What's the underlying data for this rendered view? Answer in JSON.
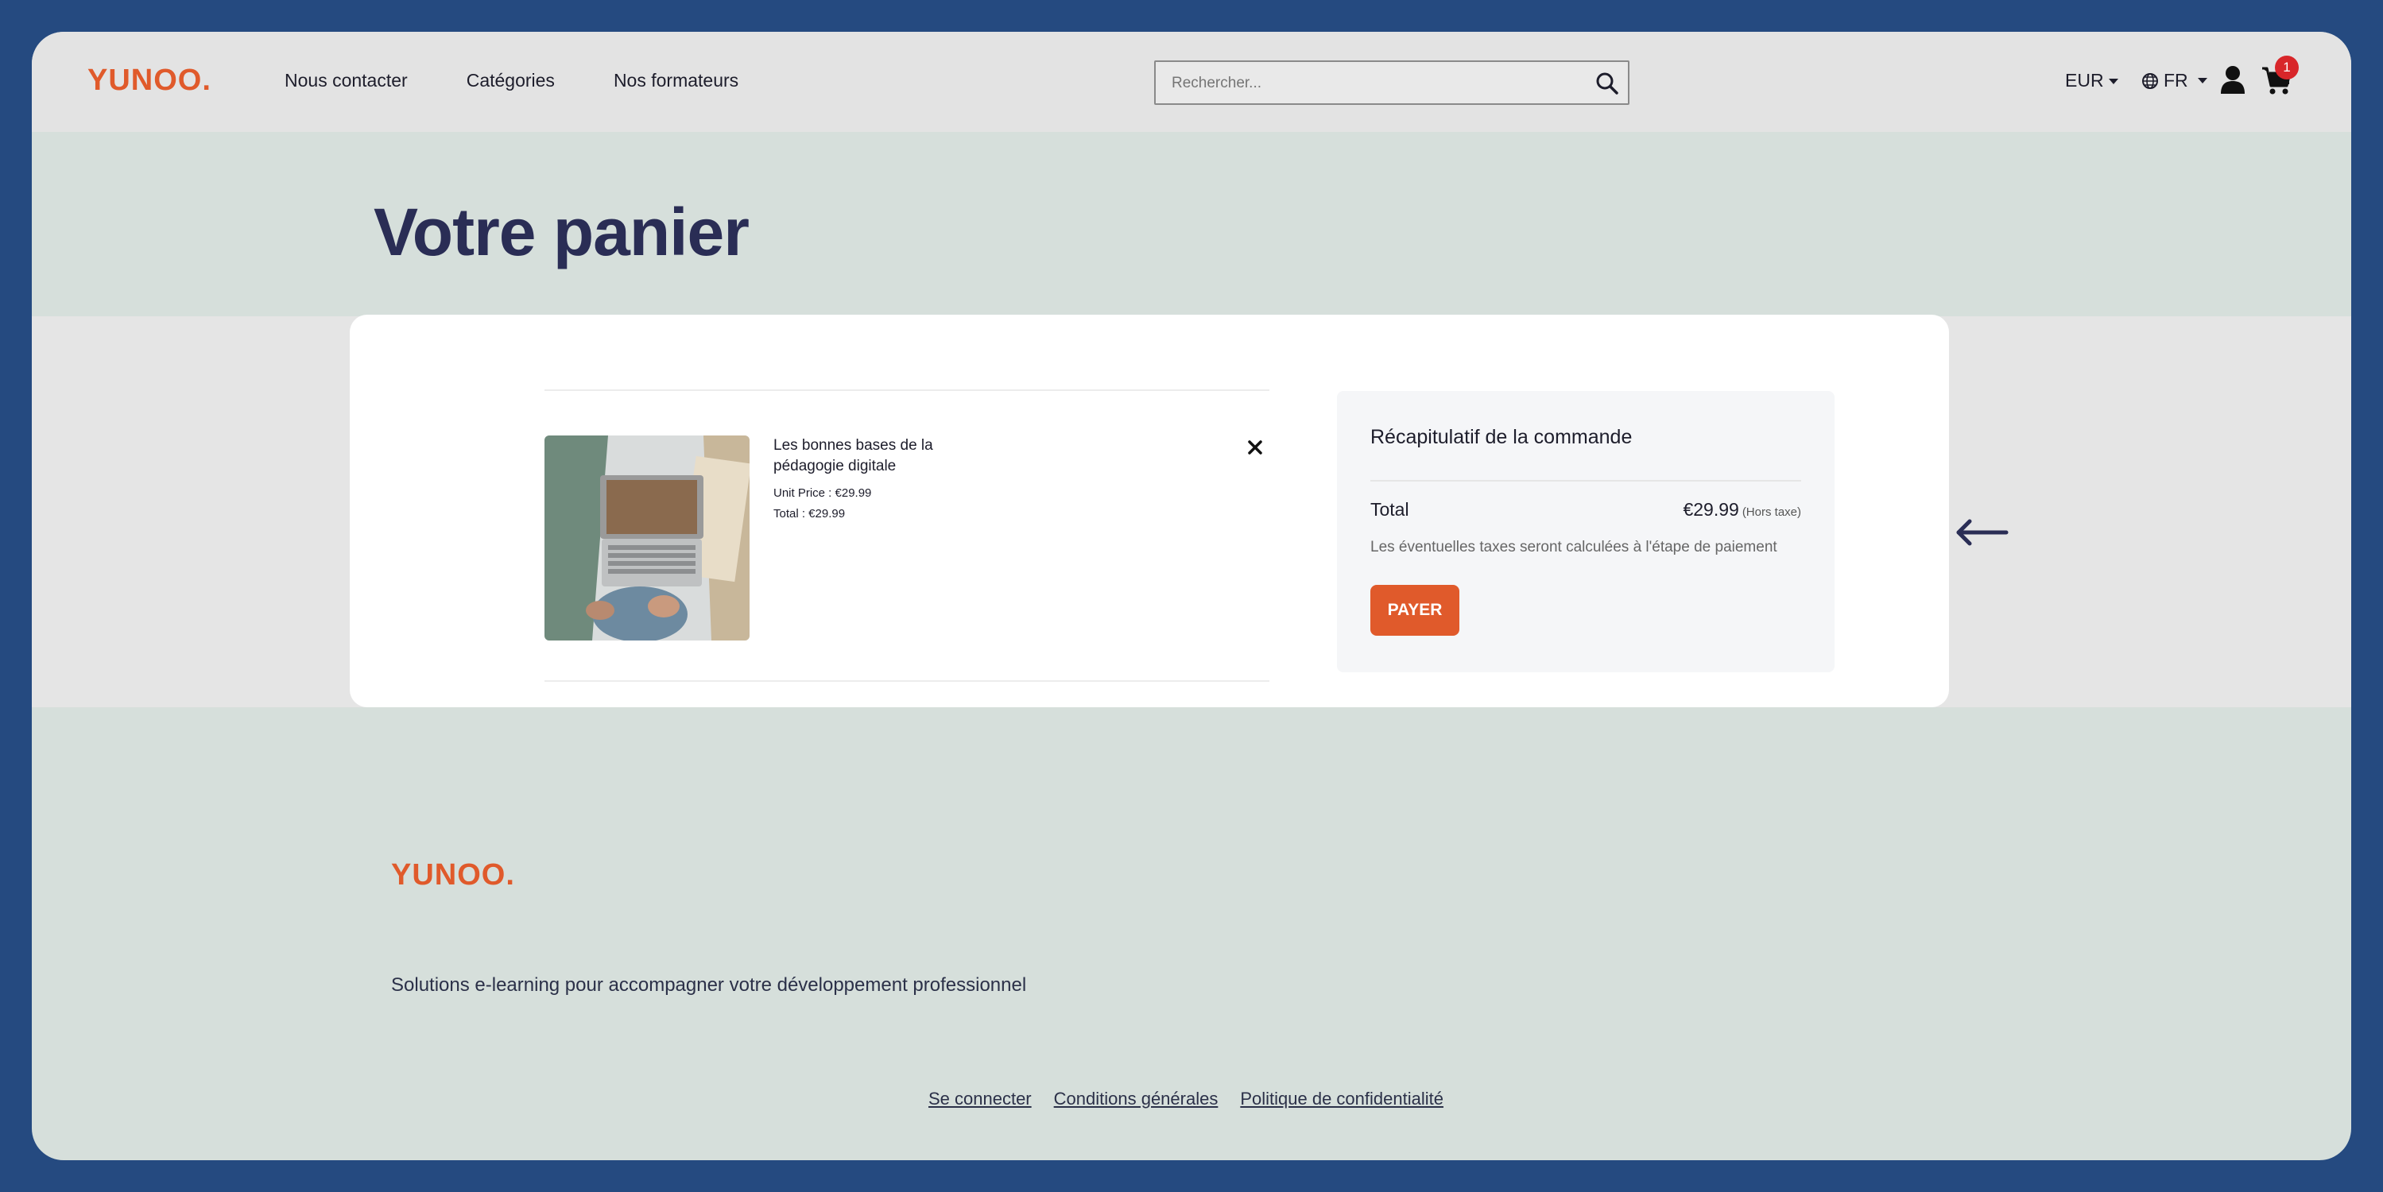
{
  "header": {
    "logo": "YUNOO.",
    "nav": [
      "Nous contacter",
      "Catégories",
      "Nos formateurs"
    ],
    "search_placeholder": "Rechercher...",
    "currency": "EUR",
    "language": "FR",
    "cart_count": "1"
  },
  "page": {
    "title": "Votre panier"
  },
  "cart": {
    "item": {
      "title": "Les bonnes bases de la pédagogie digitale",
      "unit_price": "Unit Price : €29.99",
      "total": "Total : €29.99"
    }
  },
  "summary": {
    "heading": "Récapitulatif de la commande",
    "total_label": "Total",
    "total_value": "€29.99",
    "total_suffix": "(Hors taxe)",
    "tax_note": "Les éventuelles taxes seront calculées à l'étape de paiement",
    "pay_label": "PAYER"
  },
  "footer": {
    "logo": "YUNOO.",
    "tagline": "Solutions e-learning pour accompagner votre développement professionnel",
    "links": [
      "Se connecter",
      "Conditions générales",
      "Politique de confidentialité"
    ]
  },
  "colors": {
    "brand_orange": "#e05a2b",
    "title_navy": "#2a2d55",
    "badge_red": "#d8262a",
    "outer_background": "#254a80"
  }
}
